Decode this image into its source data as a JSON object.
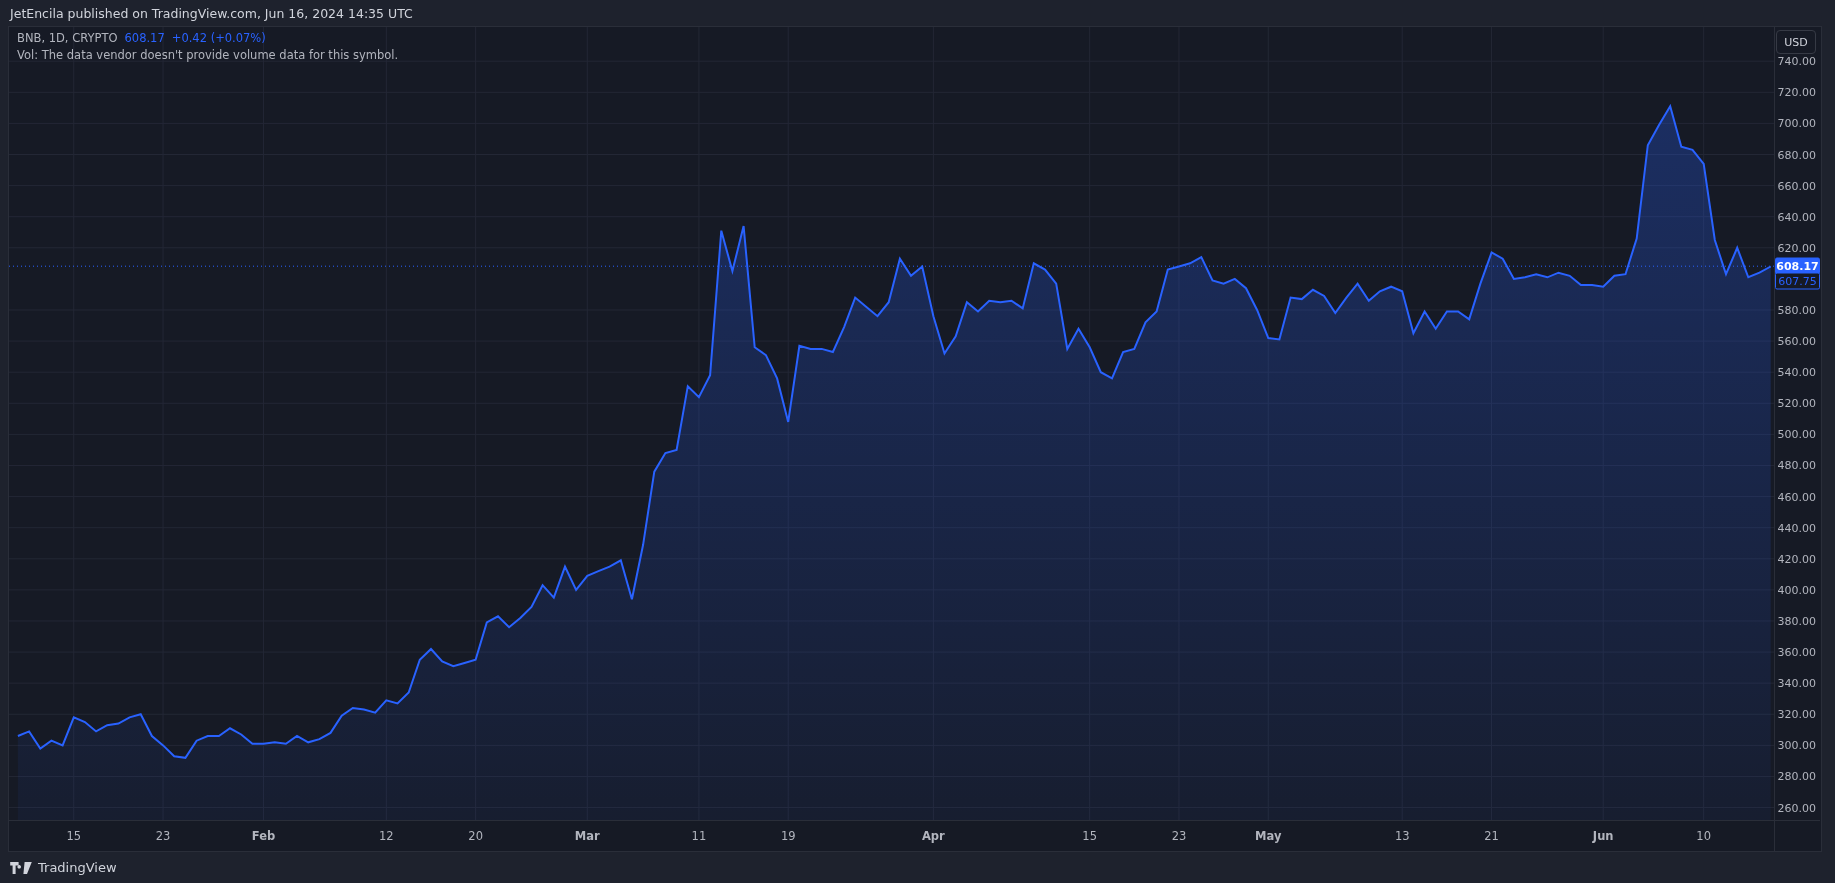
{
  "header": {
    "text": "JetEncila published on TradingView.com, Jun 16, 2024 14:35 UTC"
  },
  "legend": {
    "symbol": "BNB, 1D, CRYPTO",
    "price": "608.17",
    "change": "+0.42 (+0.07%)",
    "volume_note": "Vol: The data vendor doesn't provide volume data for this symbol."
  },
  "currency_button": {
    "label": "USD"
  },
  "close_tag": {
    "text": "607.75"
  },
  "chart_data": {
    "type": "area",
    "grid": true,
    "ylim": [
      252,
      762
    ],
    "categories": [
      null,
      null,
      null,
      null,
      null,
      "15",
      null,
      null,
      null,
      null,
      null,
      null,
      null,
      "23",
      null,
      null,
      null,
      null,
      null,
      null,
      null,
      null,
      "Feb",
      null,
      null,
      null,
      null,
      null,
      null,
      null,
      null,
      null,
      null,
      "12",
      null,
      null,
      null,
      null,
      null,
      null,
      null,
      "20",
      null,
      null,
      null,
      null,
      null,
      null,
      null,
      null,
      null,
      "Mar",
      null,
      null,
      null,
      null,
      null,
      null,
      null,
      null,
      null,
      "11",
      null,
      null,
      null,
      null,
      null,
      null,
      null,
      "19",
      null,
      null,
      null,
      null,
      null,
      null,
      null,
      null,
      null,
      null,
      null,
      null,
      "Apr",
      null,
      null,
      null,
      null,
      null,
      null,
      null,
      null,
      null,
      null,
      null,
      null,
      null,
      "15",
      null,
      null,
      null,
      null,
      null,
      null,
      null,
      "23",
      null,
      null,
      null,
      null,
      null,
      null,
      null,
      "May",
      null,
      null,
      null,
      null,
      null,
      null,
      null,
      null,
      null,
      null,
      null,
      "13",
      null,
      null,
      null,
      null,
      null,
      null,
      null,
      "21",
      null,
      null,
      null,
      null,
      null,
      null,
      null,
      null,
      null,
      "Jun",
      null,
      null,
      null,
      null,
      null,
      null,
      null,
      null,
      "10",
      null,
      null,
      null,
      null,
      null,
      null
    ],
    "yticks": [
      {
        "value": 260,
        "label": "260.00"
      },
      {
        "value": 280,
        "label": "280.00"
      },
      {
        "value": 300,
        "label": "300.00"
      },
      {
        "value": 320,
        "label": "320.00"
      },
      {
        "value": 340,
        "label": "340.00"
      },
      {
        "value": 360,
        "label": "360.00"
      },
      {
        "value": 380,
        "label": "380.00"
      },
      {
        "value": 400,
        "label": "400.00"
      },
      {
        "value": 420,
        "label": "420.00"
      },
      {
        "value": 440,
        "label": "440.00"
      },
      {
        "value": 460,
        "label": "460.00"
      },
      {
        "value": 480,
        "label": "480.00"
      },
      {
        "value": 500,
        "label": "500.00"
      },
      {
        "value": 520,
        "label": "520.00"
      },
      {
        "value": 540,
        "label": "540.00"
      },
      {
        "value": 560,
        "label": "560.00"
      },
      {
        "value": 580,
        "label": "580.00"
      },
      {
        "value": 620,
        "label": "620.00"
      },
      {
        "value": 640,
        "label": "640.00"
      },
      {
        "value": 660,
        "label": "660.00"
      },
      {
        "value": 680,
        "label": "680.00"
      },
      {
        "value": 700,
        "label": "700.00"
      },
      {
        "value": 720,
        "label": "720.00"
      },
      {
        "value": 740,
        "label": "740.00"
      }
    ],
    "series": [
      {
        "color": "#2962ff",
        "values": [
          306,
          309,
          298,
          303,
          300,
          318,
          315,
          309,
          313,
          314,
          318,
          320,
          306,
          300,
          293,
          292,
          303,
          306,
          306,
          311,
          307,
          301,
          301,
          302,
          301,
          306,
          302,
          304,
          308,
          319,
          324,
          323,
          321,
          329,
          327,
          334,
          355,
          362,
          354,
          351,
          353,
          355,
          379,
          383,
          376,
          382,
          389,
          403,
          395,
          415,
          400,
          409,
          412,
          415,
          419,
          394,
          429,
          476,
          488,
          490,
          531,
          524,
          538,
          631,
          605,
          634,
          556,
          551,
          536,
          508,
          557,
          555,
          555,
          553,
          569,
          588,
          582,
          576,
          585,
          613,
          602,
          608,
          576,
          552,
          563,
          585,
          579,
          586,
          585,
          586,
          581,
          610,
          606,
          597,
          555,
          568,
          556,
          540,
          536,
          553,
          555,
          572,
          579,
          606,
          608,
          610,
          614,
          599,
          597,
          600,
          594,
          580,
          562,
          561,
          588,
          587,
          593,
          589,
          578,
          588,
          597,
          586,
          592,
          595,
          592,
          565,
          579,
          568,
          579,
          579,
          574,
          597,
          617,
          613,
          600,
          601,
          603,
          601,
          604,
          602,
          596,
          596,
          595,
          602,
          603,
          626,
          686,
          699,
          711,
          685,
          683,
          674,
          625,
          603,
          620,
          601,
          604,
          608
        ]
      }
    ],
    "ref_lines": [
      {
        "axis": "y",
        "value": 608.17,
        "label": "608.17"
      }
    ]
  },
  "footer": {
    "brand": "TradingView"
  }
}
